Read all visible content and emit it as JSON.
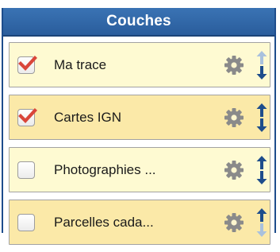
{
  "panel": {
    "title": "Couches"
  },
  "colors": {
    "header": "#2a5d9c",
    "row_light": "#fefad2",
    "row_dark": "#fbe9a8",
    "check": "#d9463a",
    "arrow_active": "#1e4d8c",
    "arrow_disabled": "#a9c1dd",
    "gear": "#8a8a8a"
  },
  "layers": [
    {
      "label": "Ma trace",
      "checked": true,
      "shade": "light",
      "move_up_enabled": false,
      "move_down_enabled": true,
      "settings_icon": "gear-icon"
    },
    {
      "label": "Cartes IGN",
      "checked": true,
      "shade": "dark",
      "move_up_enabled": true,
      "move_down_enabled": true,
      "settings_icon": "gear-icon"
    },
    {
      "label": "Photographies ...",
      "checked": false,
      "shade": "light",
      "move_up_enabled": true,
      "move_down_enabled": true,
      "settings_icon": "gear-icon"
    },
    {
      "label": "Parcelles cada...",
      "checked": false,
      "shade": "dark",
      "move_up_enabled": true,
      "move_down_enabled": false,
      "settings_icon": "gear-icon"
    }
  ]
}
